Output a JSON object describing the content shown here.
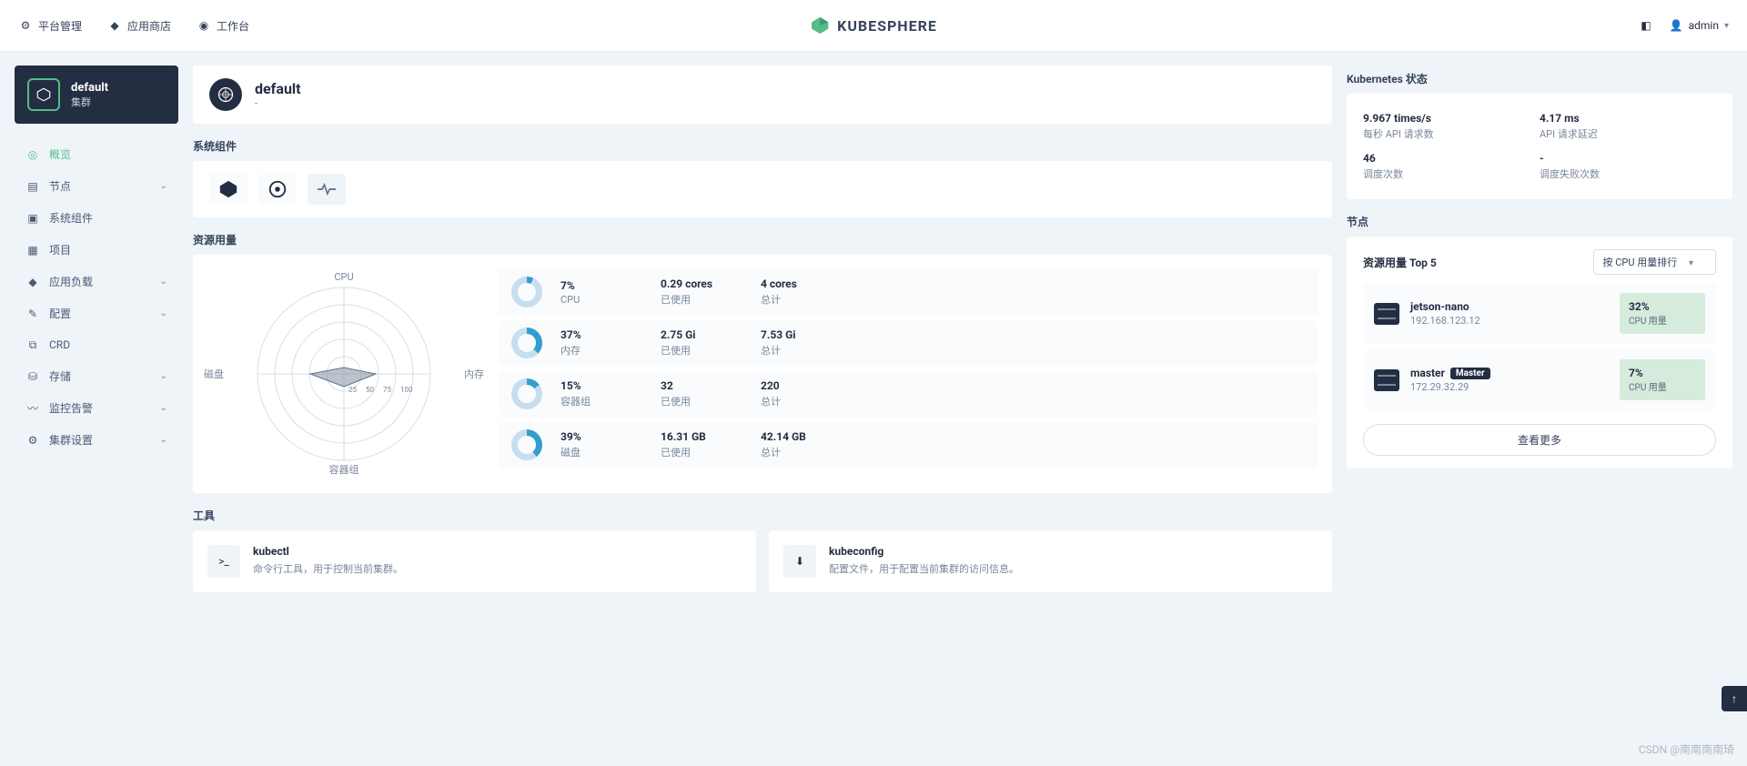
{
  "topbar": {
    "platform": "平台管理",
    "appstore": "应用商店",
    "workbench": "工作台",
    "brand": "KUBESPHERE",
    "user": "admin"
  },
  "cluster": {
    "name": "default",
    "sub": "集群"
  },
  "nav": [
    {
      "label": "概览",
      "icon": "overview",
      "active": true,
      "expandable": false
    },
    {
      "label": "节点",
      "icon": "nodes",
      "expandable": true
    },
    {
      "label": "系统组件",
      "icon": "components",
      "expandable": false
    },
    {
      "label": "项目",
      "icon": "projects",
      "expandable": false
    },
    {
      "label": "应用负载",
      "icon": "workloads",
      "expandable": true
    },
    {
      "label": "配置",
      "icon": "config",
      "expandable": true
    },
    {
      "label": "CRD",
      "icon": "crd",
      "expandable": false
    },
    {
      "label": "存储",
      "icon": "storage",
      "expandable": true
    },
    {
      "label": "监控告警",
      "icon": "monitor",
      "expandable": true
    },
    {
      "label": "集群设置",
      "icon": "settings",
      "expandable": true
    }
  ],
  "header": {
    "title": "default",
    "sub": "-"
  },
  "sections": {
    "components": "系统组件",
    "resources": "资源用量",
    "tools": "工具",
    "kstatus": "Kubernetes 状态",
    "nodes": "节点"
  },
  "radar": {
    "axes": [
      "CPU",
      "内存",
      "容器组",
      "磁盘"
    ]
  },
  "metrics": [
    {
      "pct": "7%",
      "name": "CPU",
      "used": "0.29 cores",
      "usedLbl": "已使用",
      "total": "4 cores",
      "totalLbl": "总计",
      "p": 7
    },
    {
      "pct": "37%",
      "name": "内存",
      "used": "2.75 Gi",
      "usedLbl": "已使用",
      "total": "7.53 Gi",
      "totalLbl": "总计",
      "p": 37
    },
    {
      "pct": "15%",
      "name": "容器组",
      "used": "32",
      "usedLbl": "已使用",
      "total": "220",
      "totalLbl": "总计",
      "p": 15
    },
    {
      "pct": "39%",
      "name": "磁盘",
      "used": "16.31 GB",
      "usedLbl": "已使用",
      "total": "42.14 GB",
      "totalLbl": "总计",
      "p": 39
    }
  ],
  "tools": [
    {
      "title": "kubectl",
      "desc": "命令行工具，用于控制当前集群。",
      "icon": "terminal"
    },
    {
      "title": "kubeconfig",
      "desc": "配置文件，用于配置当前集群的访问信息。",
      "icon": "download"
    }
  ],
  "kstatus": [
    {
      "val": "9.967 times/s",
      "lbl": "每秒 API 请求数"
    },
    {
      "val": "4.17 ms",
      "lbl": "API 请求延迟"
    },
    {
      "val": "46",
      "lbl": "调度次数"
    },
    {
      "val": "-",
      "lbl": "调度失败次数"
    }
  ],
  "nodes": {
    "topLabel": "资源用量 Top 5",
    "sortLabel": "按 CPU 用量排行",
    "list": [
      {
        "name": "jetson-nano",
        "ip": "192.168.123.12",
        "master": false,
        "pct": "32%",
        "lbl": "CPU 用量"
      },
      {
        "name": "master",
        "ip": "172.29.32.29",
        "master": true,
        "masterText": "Master",
        "pct": "7%",
        "lbl": "CPU 用量"
      }
    ],
    "more": "查看更多"
  },
  "watermark": "CSDN @南南南南琦",
  "chart_data": {
    "type": "radar",
    "axes": [
      "CPU",
      "内存",
      "容器组",
      "磁盘"
    ],
    "values_pct": [
      7,
      37,
      15,
      39
    ],
    "range": [
      0,
      100
    ]
  }
}
